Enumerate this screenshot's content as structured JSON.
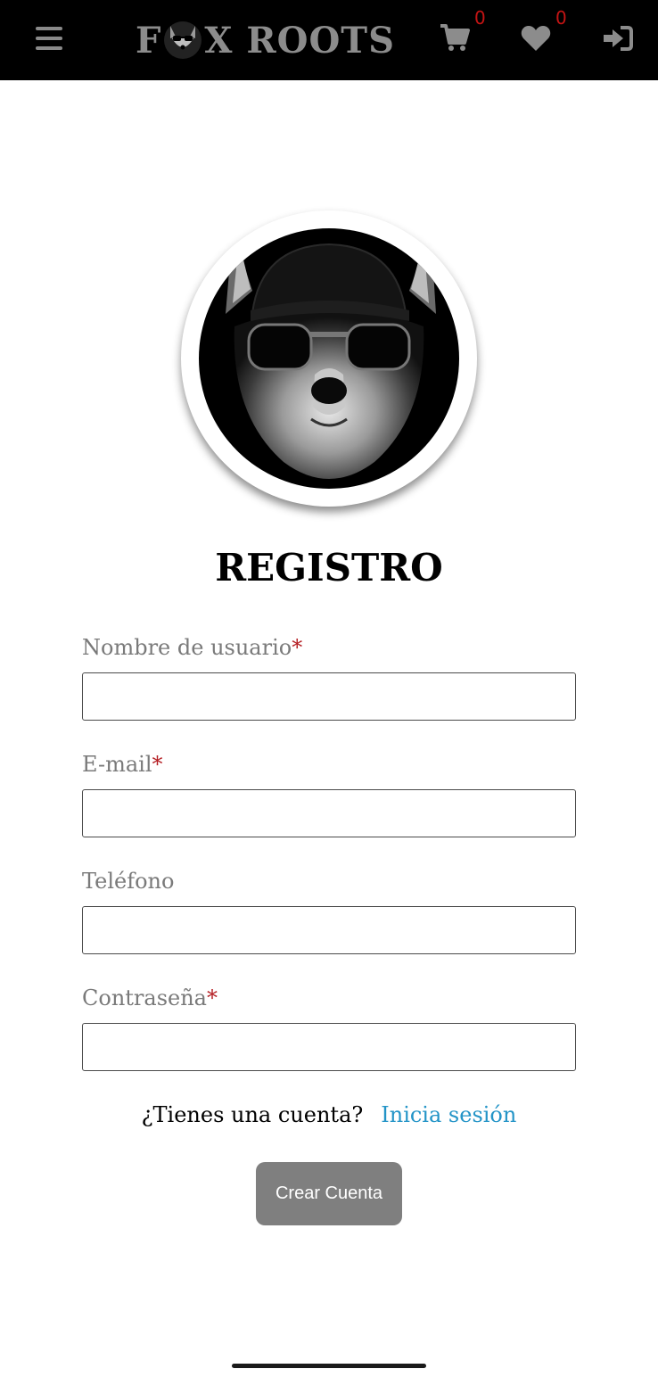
{
  "header": {
    "brand_left": "F",
    "brand_right": "X ROOTS",
    "cart_count": "0",
    "wishlist_count": "0",
    "icons": [
      "hamburger-menu-icon",
      "cart-icon",
      "heart-icon",
      "sign-in-icon"
    ],
    "badge_color": "#c41414"
  },
  "page": {
    "title": "REGISTRO"
  },
  "form": {
    "username": {
      "label": "Nombre de usuario",
      "required_mark": "*",
      "value": "",
      "placeholder": ""
    },
    "email": {
      "label": "E-mail",
      "required_mark": "*",
      "value": "",
      "placeholder": ""
    },
    "phone": {
      "label": "Teléfono",
      "value": "",
      "placeholder": ""
    },
    "password": {
      "label": "Contraseña",
      "required_mark": "*",
      "value": "",
      "placeholder": ""
    },
    "account_prompt": "¿Tienes una cuenta?",
    "login_link": "Inicia sesión",
    "submit_label": "Crear Cuenta"
  },
  "colors": {
    "header_bg": "#000000",
    "required": "#b51f24",
    "link": "#2394c7",
    "button_bg": "#7f7f7f"
  }
}
